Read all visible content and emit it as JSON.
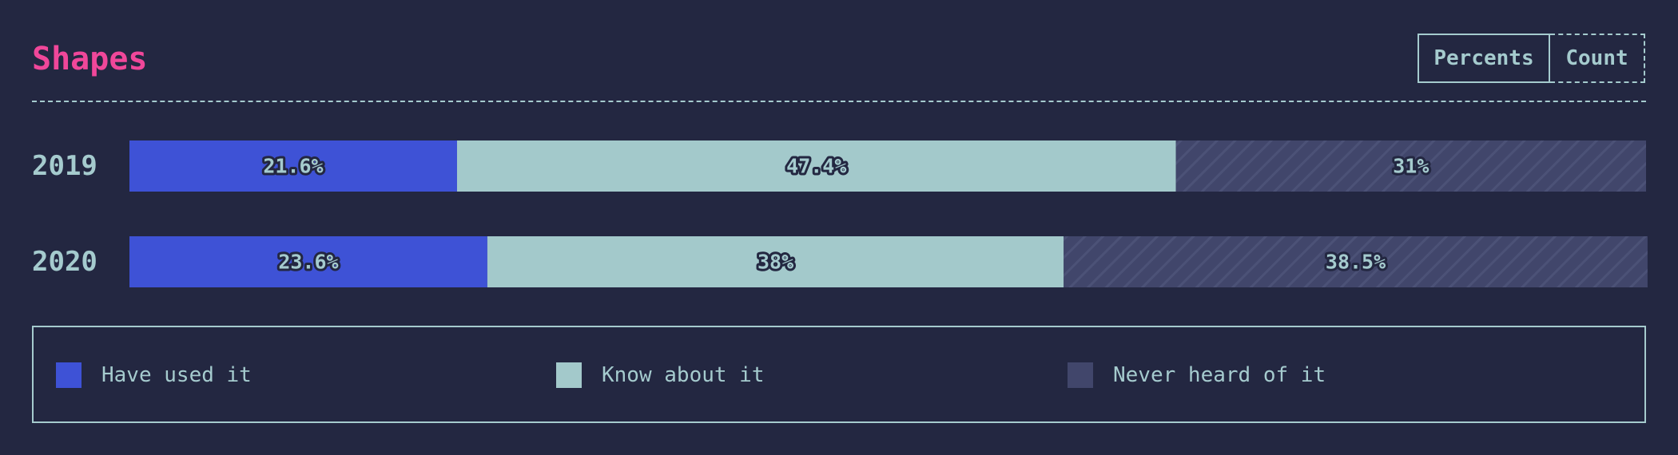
{
  "title": "Shapes",
  "toggle": {
    "percents_label": "Percents",
    "count_label": "Count",
    "active": "Percents"
  },
  "chart_data": {
    "type": "bar",
    "orientation": "horizontal",
    "stacked": true,
    "normalized": true,
    "categories": [
      "2019",
      "2020"
    ],
    "series": [
      {
        "name": "Have used it",
        "values": [
          21.6,
          23.6
        ],
        "labels": [
          "21.6%",
          "23.6%"
        ],
        "color": "#3e52d6",
        "pattern": "solid"
      },
      {
        "name": "Know about it",
        "values": [
          47.4,
          38.0
        ],
        "labels": [
          "47.4%",
          "38%"
        ],
        "color": "#a3c9cb",
        "pattern": "solid"
      },
      {
        "name": "Never heard of it",
        "values": [
          31.0,
          38.5
        ],
        "labels": [
          "31%",
          "38.5%"
        ],
        "color": "#41466b",
        "pattern": "hatched"
      }
    ],
    "xlim": [
      0,
      100
    ],
    "grid": false,
    "legend_position": "bottom"
  },
  "legend": {
    "items": [
      {
        "label": "Have used it",
        "color": "#3e52d6"
      },
      {
        "label": "Know about it",
        "color": "#a3c9cb"
      },
      {
        "label": "Never heard of it",
        "color": "#41466b"
      }
    ]
  },
  "colors": {
    "background": "#232741",
    "accent": "#f0479a",
    "text": "#a5cbce"
  }
}
